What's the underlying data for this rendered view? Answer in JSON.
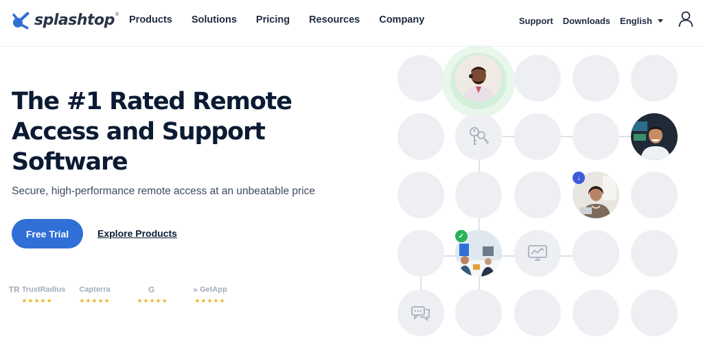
{
  "brand": {
    "name": "splashtop",
    "reg": "®"
  },
  "nav": {
    "items": [
      "Products",
      "Solutions",
      "Pricing",
      "Resources",
      "Company"
    ]
  },
  "utility": {
    "support": "Support",
    "downloads": "Downloads",
    "language": "English"
  },
  "hero": {
    "headline": "The #1 Rated Remote Access and Support Software",
    "subline": "Secure, high-performance remote access at an unbeatable price",
    "cta": "Free Trial",
    "secondary": "Explore Products"
  },
  "ratings": [
    {
      "name": "TrustRadius",
      "glyph": "TR",
      "stars": "★★★★★"
    },
    {
      "name": "Capterra",
      "glyph": "",
      "stars": "★★★★★"
    },
    {
      "name": "",
      "glyph": "G",
      "stars": "★★★★★"
    },
    {
      "name": "GetApp",
      "glyph": "»",
      "stars": "★★★★★"
    }
  ],
  "colors": {
    "accent": "#2f6fd6",
    "check": "#2bb15a",
    "download": "#3b5bdb",
    "circle": "#edeff2",
    "text": "#0b1b33"
  },
  "visual": {
    "icons": [
      "keys-icon",
      "monitor-chart-icon",
      "chat-icon"
    ],
    "badges": [
      "check-badge-icon",
      "download-badge-icon"
    ]
  }
}
